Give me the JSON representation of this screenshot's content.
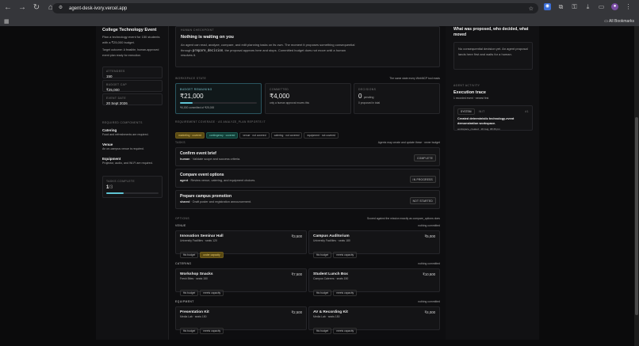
{
  "browser": {
    "url": "agent-desk-ivory.vercel.app",
    "bookmarks_label": "All Bookmarks"
  },
  "left": {
    "title": "College Technology Event",
    "desc": "Plan a technology event for 150 students with a ₹25,000 budget.",
    "target": "Target outcome: A feasible, human-approved event plan ready for execution.",
    "stats": [
      {
        "label": "ATTENDEES",
        "value": "150"
      },
      {
        "label": "BUDGET CAP",
        "value": "₹25,000"
      },
      {
        "label": "EVENT DATE",
        "value": "20 Sept 2026"
      }
    ],
    "req_title": "REQUIRED COMPONENTS",
    "reqs": [
      {
        "name": "Catering",
        "desc": "Food and refreshments are required."
      },
      {
        "name": "Venue",
        "desc": "An on-campus venue is required."
      },
      {
        "name": "Equipment",
        "desc": "Projector, audio, and Wi-Fi are required."
      }
    ],
    "tasks_label": "TASKS COMPLETE",
    "tasks_done": "1",
    "tasks_total": "/3",
    "tasks_progress": 0.33
  },
  "checkpoint": {
    "label": "HUMAN CHECKPOINT",
    "title": "Nothing is waiting on you",
    "text1": "An agent can read, analyze, compare, and edit planning tasks on its own. The moment it proposes something consequential through",
    "code": "prepare_decision",
    "text2": ", the proposal appears here and stops. Committed budget does not move until a human resolves it."
  },
  "state": {
    "label": "WORKSPACE STATE",
    "note": "The same state every WebMCP tool reads",
    "budget": {
      "label": "BUDGET REMAINING",
      "value": "₹21,000",
      "sub": "₹4,000 committed of ₹25,000",
      "progress": 0.16
    },
    "committed": {
      "label": "COMMITTED",
      "value": "₹4,000",
      "sub": "only a human approval moves this"
    },
    "decisions": {
      "label": "DECISIONS",
      "value": "0",
      "value_sub": "pending",
      "sub": "0 proposed in total"
    },
    "coverage_label": "REQUIREMENT COVERAGE · AS ANALYZE_PLAN REPORTS IT",
    "coverage": [
      {
        "text": "marketing · covered",
        "style": "y"
      },
      {
        "text": "contingency · covered",
        "style": "g"
      },
      {
        "text": "venue · not covered",
        "style": ""
      },
      {
        "text": "catering · not covered",
        "style": ""
      },
      {
        "text": "equipment · not covered",
        "style": ""
      }
    ]
  },
  "tasks": {
    "label": "TASKS",
    "note": "Agents may create and update these · never budget",
    "items": [
      {
        "title": "Confirm event brief",
        "owner": "human",
        "desc": " · Validate scope and success criteria.",
        "status": "COMPLETE"
      },
      {
        "title": "Compare event options",
        "owner": "agent",
        "desc": " · Review venue, catering, and equipment choices.",
        "status": "IN PROGRESS"
      },
      {
        "title": "Prepare campus promotion",
        "owner": "shared",
        "desc": " · Draft poster and registration announcement.",
        "status": "NOT STARTED"
      }
    ]
  },
  "options": {
    "label": "OPTIONS",
    "note": "Scored against the mission exactly as compare_options does",
    "groups": [
      {
        "name": "VENUE",
        "status": "nothing committed",
        "items": [
          {
            "title": "Innovation Seminar Hall",
            "price": "₹3,500",
            "meta": "University Facilities · seats 120",
            "tags": [
              {
                "t": "fits budget",
                "s": ""
              },
              {
                "t": "under capacity",
                "s": "y"
              }
            ]
          },
          {
            "title": "Campus Auditorium",
            "price": "₹5,000",
            "meta": "University Facilities · seats 180",
            "tags": [
              {
                "t": "fits budget",
                "s": ""
              },
              {
                "t": "meets capacity",
                "s": ""
              }
            ]
          }
        ]
      },
      {
        "name": "CATERING",
        "status": "nothing committed",
        "items": [
          {
            "title": "Workshop Snacks",
            "price": "₹7,500",
            "meta": "Fresh Bites · seats 150",
            "tags": [
              {
                "t": "fits budget",
                "s": ""
              },
              {
                "t": "meets capacity",
                "s": ""
              }
            ]
          },
          {
            "title": "Student Lunch Box",
            "price": "₹10,500",
            "meta": "Campus Caterers · seats 150",
            "tags": [
              {
                "t": "fits budget",
                "s": ""
              },
              {
                "t": "meets capacity",
                "s": ""
              }
            ]
          }
        ]
      },
      {
        "name": "EQUIPMENT",
        "status": "nothing committed",
        "items": [
          {
            "title": "Presentation Kit",
            "price": "₹2,500",
            "meta": "Media Lab · seats 150",
            "tags": [
              {
                "t": "fits budget",
                "s": ""
              },
              {
                "t": "meets capacity",
                "s": ""
              }
            ]
          },
          {
            "title": "AV & Recording Kit",
            "price": "₹4,000",
            "meta": "Media Lab · seats 150",
            "tags": [
              {
                "t": "fits budget",
                "s": ""
              },
              {
                "t": "meets capacity",
                "s": ""
              }
            ]
          }
        ]
      }
    ]
  },
  "right": {
    "title": "What was proposed, who decided, what moved",
    "empty": "No consequential decision yet. An agent proposal lands here first and waits for a human.",
    "activity_label": "AGENT ACTIVITY",
    "trace_title": "Execution trace",
    "trace_sub": "1 recorded event · newest first",
    "event": {
      "tag": "SYSTEM",
      "kind": "INIT",
      "num": "#1",
      "title": "Created deterministic technology-event demonstration workspace.",
      "meta": "workspace_created · 20 Aug, 08:36 pm"
    }
  }
}
